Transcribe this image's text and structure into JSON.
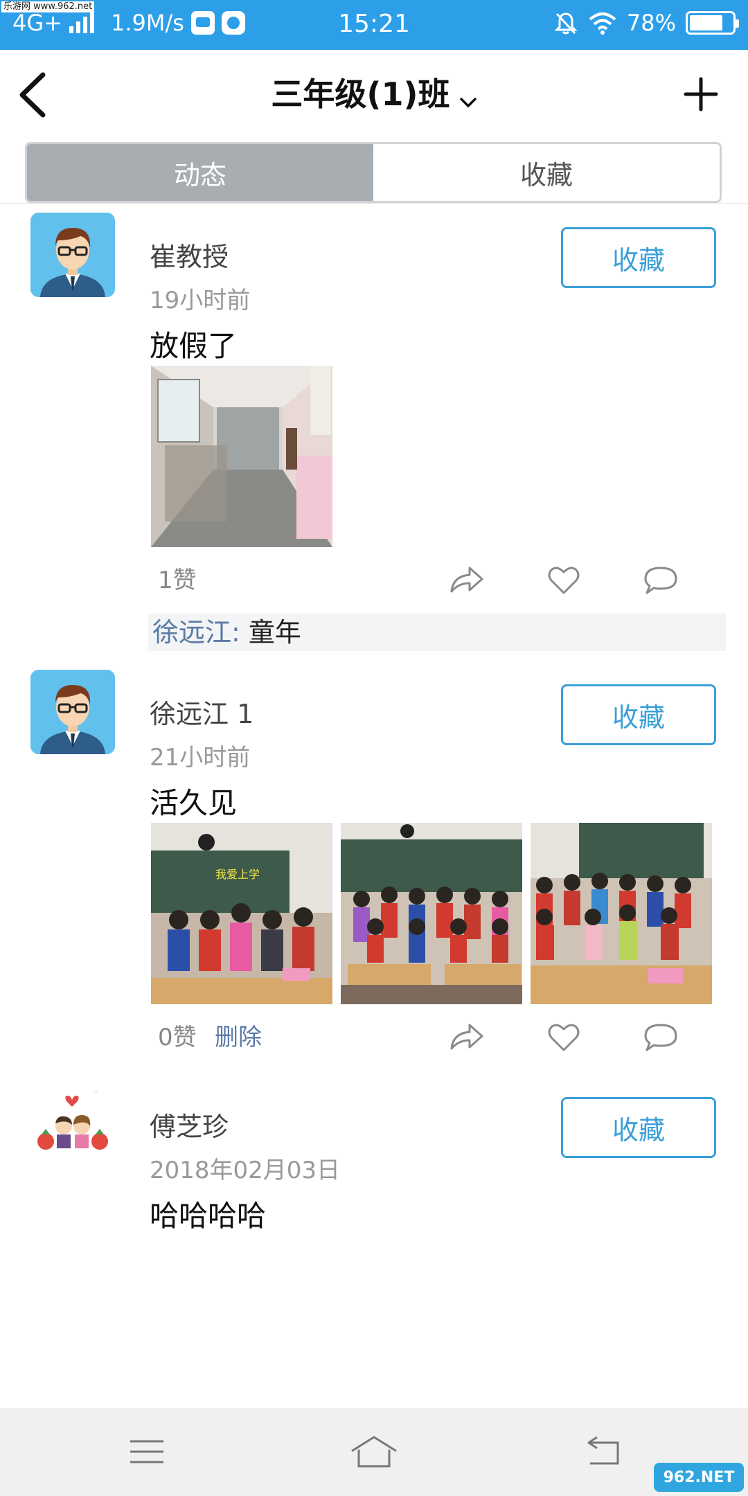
{
  "watermark": {
    "top_left": "乐游网 www.962.net",
    "bottom_right": "962.NET"
  },
  "statusbar": {
    "network": "4G+",
    "speed": "1.9M/s",
    "time": "15:21",
    "battery": "78%",
    "icons": [
      "signal-icon",
      "message-icon",
      "app-icon",
      "mute-icon",
      "wifi-icon",
      "battery-icon"
    ]
  },
  "header": {
    "title": "三年级(1)班",
    "back_icon": "chevron-left-icon",
    "add_icon": "plus-icon"
  },
  "tabs": [
    {
      "label": "动态",
      "active": true
    },
    {
      "label": "收藏",
      "active": false
    }
  ],
  "posts": [
    {
      "author": "崔教授",
      "time": "19小时前",
      "content": "放假了",
      "favorite_label": "收藏",
      "likes": "1赞",
      "comment": {
        "user": "徐远江:",
        "text": " 童年"
      }
    },
    {
      "author": "徐远江 1",
      "time": "21小时前",
      "content": "活久见",
      "favorite_label": "收藏",
      "likes": "0赞",
      "delete_label": "删除"
    },
    {
      "author": "傅芝珍",
      "time": "2018年02月03日",
      "content": "哈哈哈哈",
      "favorite_label": "收藏"
    }
  ],
  "photo_text": {
    "banner": "我爱上学"
  },
  "colors": {
    "statusbar": "#2d9fe8",
    "accent": "#3a9fd8",
    "tab_active": "#a8adb2",
    "link": "#5a7aa6"
  },
  "navbar": {
    "icons": [
      "menu-icon",
      "home-icon",
      "back-icon"
    ]
  }
}
